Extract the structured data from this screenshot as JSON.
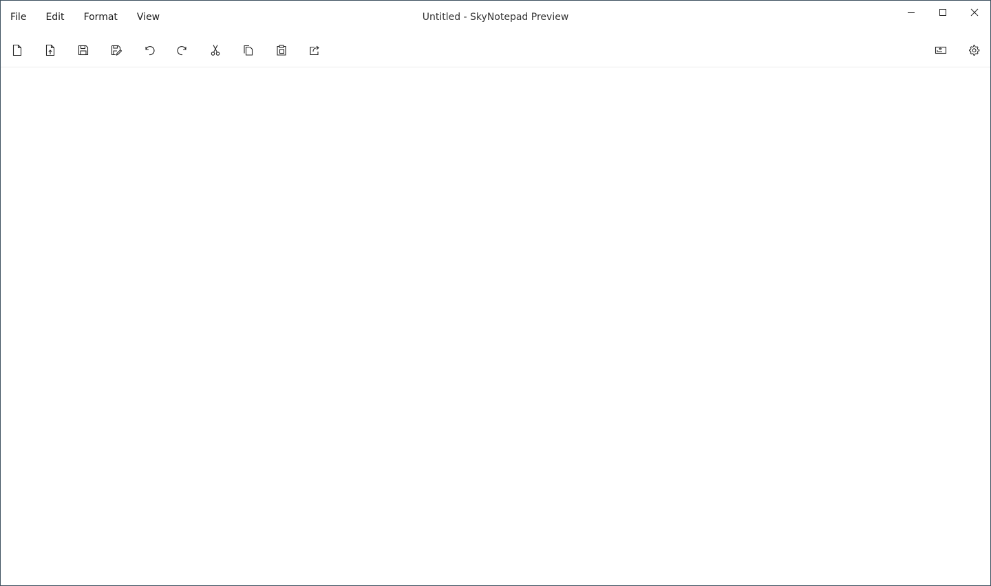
{
  "window": {
    "title": "Untitled - SkyNotepad Preview"
  },
  "menu": {
    "items": [
      {
        "label": "File"
      },
      {
        "label": "Edit"
      },
      {
        "label": "Format"
      },
      {
        "label": "View"
      }
    ]
  },
  "caption": {
    "icons": [
      "minimize-icon",
      "maximize-icon",
      "close-icon"
    ]
  },
  "toolbar": {
    "left_icons": [
      "new-file-icon",
      "open-file-icon",
      "save-icon",
      "save-as-icon",
      "undo-icon",
      "redo-icon",
      "cut-icon",
      "copy-icon",
      "paste-icon",
      "share-icon"
    ],
    "right_icons": [
      "full-screen-icon",
      "settings-icon"
    ]
  },
  "editor": {
    "content": ""
  },
  "colors": {
    "window_border": "#3c4f5e",
    "icon_stroke": "#222222",
    "divider": "#ebebeb"
  }
}
